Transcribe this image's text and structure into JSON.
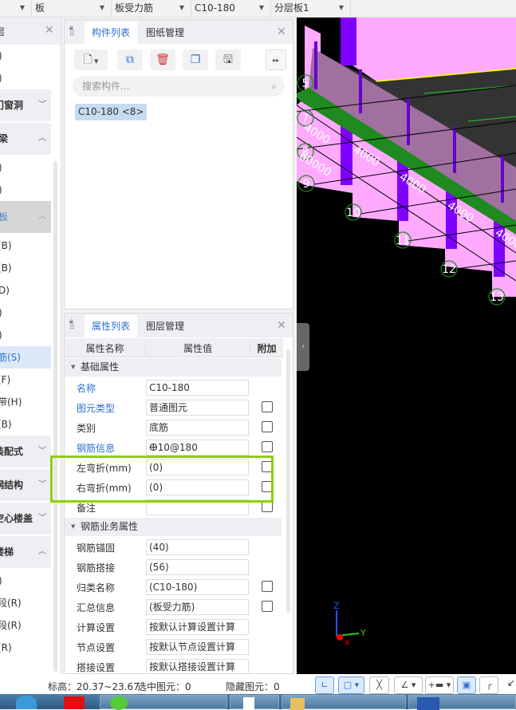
{
  "toolbar": {
    "dropdowns": [
      "",
      "板",
      "板受力筋",
      "C10-180",
      "分层板1"
    ]
  },
  "left_panel": {
    "title": "层",
    "items": [
      {
        "label": ")",
        "type": "item"
      },
      {
        "label": ")",
        "type": "item"
      },
      {
        "label": "门窗洞",
        "type": "group",
        "expanded": false
      },
      {
        "label": "梁",
        "type": "group",
        "expanded": true
      },
      {
        "label": ")",
        "type": "item"
      },
      {
        "label": ")",
        "type": "item"
      },
      {
        "label": "板",
        "type": "group-selected",
        "expanded": true
      },
      {
        "label": "(B)",
        "type": "item"
      },
      {
        "label": "(B)",
        "type": "item"
      },
      {
        "label": "D)",
        "type": "item"
      },
      {
        "label": ")",
        "type": "item"
      },
      {
        "label": ")",
        "type": "item"
      },
      {
        "label": "筋(S)",
        "type": "item-selected"
      },
      {
        "label": "(F)",
        "type": "item"
      },
      {
        "label": "带(H)",
        "type": "item"
      },
      {
        "label": "(B)",
        "type": "item"
      },
      {
        "label": "装配式",
        "type": "group",
        "expanded": false
      },
      {
        "label": "钢结构",
        "type": "group",
        "expanded": false
      },
      {
        "label": "空心楼盖",
        "type": "group",
        "expanded": false
      },
      {
        "label": "楼梯",
        "type": "group",
        "expanded": true
      },
      {
        "label": ")",
        "type": "item"
      },
      {
        "label": "段(R)",
        "type": "item"
      },
      {
        "label": "段(R)",
        "type": "item"
      },
      {
        "label": "(R)",
        "type": "item"
      }
    ]
  },
  "component_panel": {
    "tabs": [
      "构件列表",
      "图纸管理"
    ],
    "active_tab": 0,
    "search_placeholder": "搜索构件...",
    "items": [
      "C10-180 <8>"
    ]
  },
  "property_panel": {
    "tabs": [
      "属性列表",
      "图层管理"
    ],
    "active_tab": 0,
    "columns": [
      "属性名称",
      "属性值",
      "附加"
    ],
    "sections": [
      {
        "title": "基础属性",
        "rows": [
          {
            "name": "名称",
            "value": "C10-180",
            "blue": true,
            "checkbox": false
          },
          {
            "name": "图元类型",
            "value": "普通图元",
            "blue": true,
            "checkbox": true
          },
          {
            "name": "类别",
            "value": "底筋",
            "blue": false,
            "checkbox": true
          },
          {
            "name": "钢筋信息",
            "value": "ⴲ10@180",
            "blue": true,
            "checkbox": true
          },
          {
            "name": "左弯折(mm)",
            "value": "(0)",
            "blue": false,
            "checkbox": true
          },
          {
            "name": "右弯折(mm)",
            "value": "(0)",
            "blue": false,
            "checkbox": true
          },
          {
            "name": "备注",
            "value": "",
            "blue": false,
            "checkbox": true
          }
        ]
      },
      {
        "title": "钢筋业务属性",
        "rows": [
          {
            "name": "钢筋锚固",
            "value": "(40)",
            "blue": false,
            "checkbox": false
          },
          {
            "name": "钢筋搭接",
            "value": "(56)",
            "blue": false,
            "checkbox": false
          },
          {
            "name": "归类名称",
            "value": "(C10-180)",
            "blue": false,
            "checkbox": true
          },
          {
            "name": "汇总信息",
            "value": "(板受力筋)",
            "blue": false,
            "checkbox": true
          },
          {
            "name": "计算设置",
            "value": "按默认计算设置计算",
            "blue": false,
            "checkbox": false
          },
          {
            "name": "节点设置",
            "value": "按默认节点设置计算",
            "blue": false,
            "checkbox": false
          },
          {
            "name": "搭接设置",
            "value": "按默认搭接设置计算",
            "blue": false,
            "checkbox": false
          }
        ]
      }
    ],
    "highlight_color": "#8fce00"
  },
  "viewport": {
    "axis_labels": [
      "5",
      "7",
      "8",
      "9",
      "10",
      "11",
      "12",
      "13"
    ],
    "dimensions": [
      "4000",
      "60000",
      "4000",
      "4000",
      "4000",
      "4000"
    ],
    "axes": {
      "z": "Z",
      "y": "Y",
      "x": "X"
    }
  },
  "status": {
    "elevation": "标高：20.37~23.67",
    "selected": "选中图元：0",
    "hidden": "隐藏图元：0"
  }
}
